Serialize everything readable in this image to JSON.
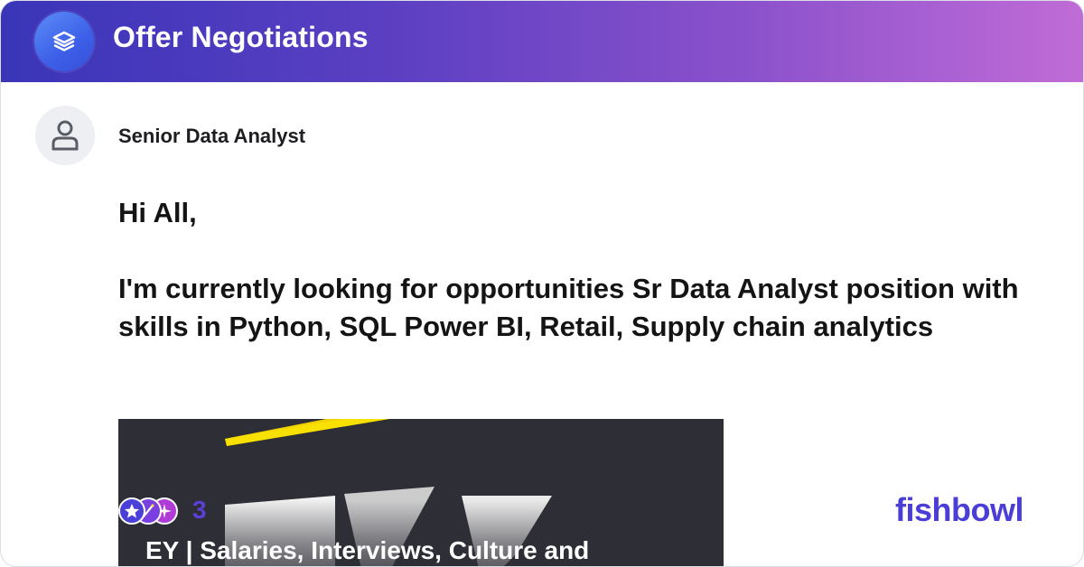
{
  "header": {
    "title": "Offer Negotiations",
    "icon": "layers-icon",
    "gradient_start": "#3a35b8",
    "gradient_end": "#c06cd6"
  },
  "post": {
    "author": "Senior Data Analyst",
    "avatar_icon": "user-icon",
    "greeting": "Hi All,",
    "body": "I'm currently looking for opportunities Sr Data Analyst position with skills in Python, SQL Power BI, Retail, Supply chain analytics"
  },
  "link_preview": {
    "title": "EY | Salaries, Interviews, Culture and"
  },
  "reactions": {
    "icons": [
      "star-reaction-icon",
      "wand-reaction-icon",
      "sparkle-reaction-icon"
    ],
    "count": "3"
  },
  "brand": {
    "name": "fishbowl",
    "color": "#4b3ed6"
  }
}
